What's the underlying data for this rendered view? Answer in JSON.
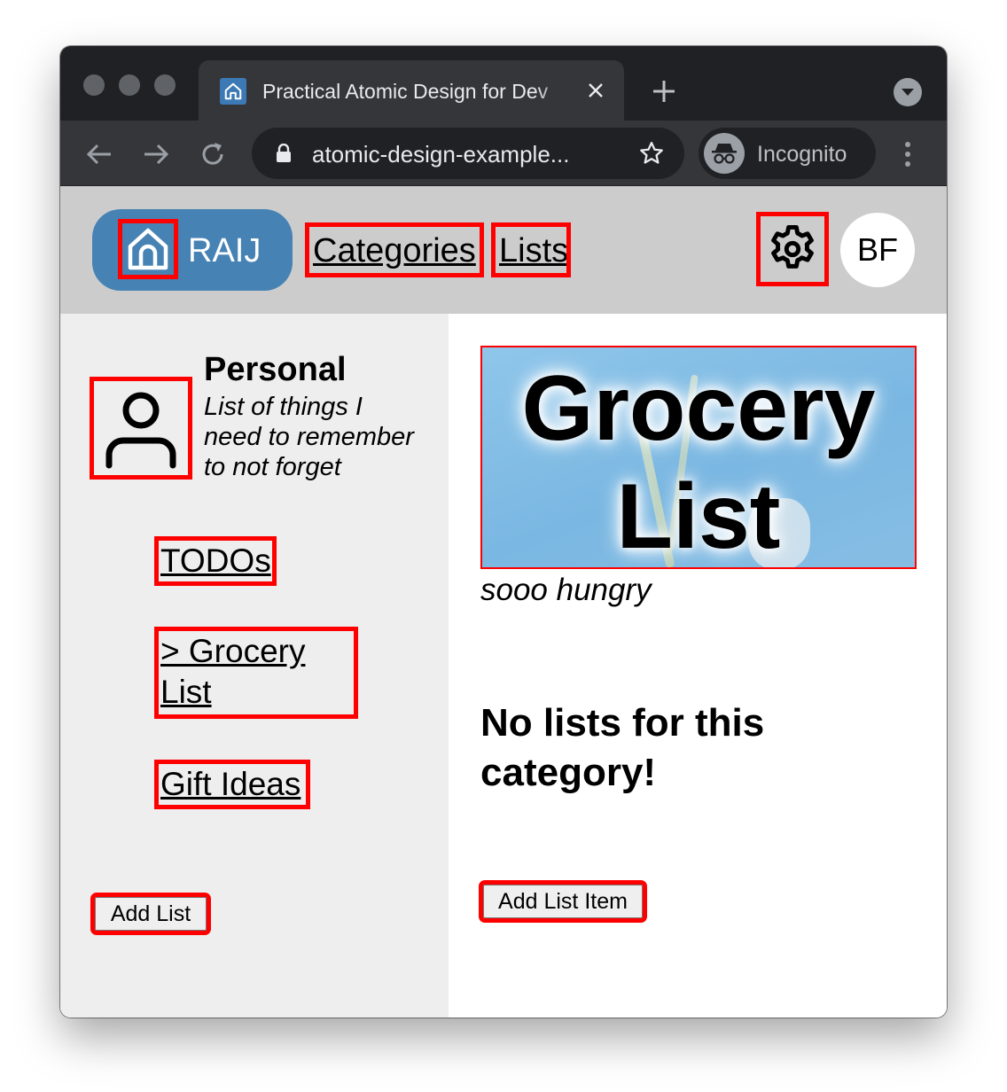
{
  "browser": {
    "tab_title": "Practical Atomic Design for Dev",
    "url": "atomic-design-example...",
    "incognito_label": "Incognito"
  },
  "app": {
    "brand": "RAIJ",
    "nav": {
      "categories": "Categories",
      "lists": "Lists"
    },
    "user_initials": "BF",
    "accent_color": "#4682b4",
    "highlight_color": "#ff0000"
  },
  "sidebar": {
    "category_name": "Personal",
    "category_description": "List of things I need to remember to not forget",
    "lists": [
      {
        "label": "TODOs"
      },
      {
        "label": "> Grocery List"
      },
      {
        "label": "Gift Ideas"
      }
    ],
    "add_list_label": "Add List"
  },
  "main": {
    "hero_title": "Grocery List",
    "hero_caption": "sooo hungry",
    "empty_message": "No lists for this category!",
    "add_item_label": "Add List Item"
  },
  "icons": {
    "favicon": "home-icon",
    "brand": "home-icon",
    "settings": "gear-icon",
    "category": "user-icon",
    "incognito": "incognito-icon"
  }
}
